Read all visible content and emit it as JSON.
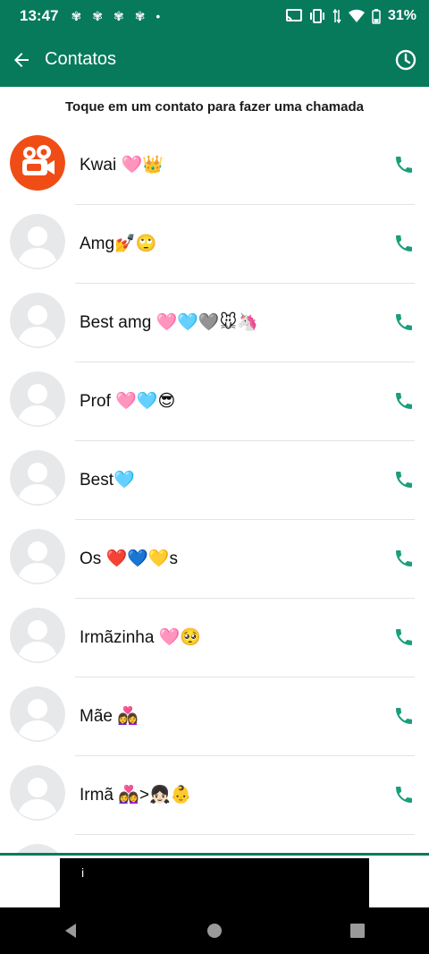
{
  "status_bar": {
    "time": "13:47",
    "notification_icons": [
      "status-icon-1",
      "status-icon-2",
      "status-icon-3",
      "status-icon-4",
      "dot"
    ],
    "battery": "31%"
  },
  "app_bar": {
    "title": "Contatos"
  },
  "hint": "Toque em um contato para fazer uma chamada",
  "contacts": [
    {
      "name": "Kwai 🩷👑",
      "avatar": "kwai"
    },
    {
      "name": "Amg💅🙄",
      "avatar": "default"
    },
    {
      "name": "Best amg 🩷🩵🩶🐭🦄",
      "avatar": "default"
    },
    {
      "name": "Prof 🩷🩵😎",
      "avatar": "default"
    },
    {
      "name": "Best🩵",
      "avatar": "default"
    },
    {
      "name": "Os ❤️💙💛s",
      "avatar": "default"
    },
    {
      "name": "Irmãzinha 🩷🥺",
      "avatar": "default"
    },
    {
      "name": "Mãe 👩‍❤️‍👩",
      "avatar": "default"
    },
    {
      "name": "Irmã 👩‍❤️‍👩>👧🏻👶",
      "avatar": "default"
    }
  ],
  "ad_banner": {
    "label": "i"
  },
  "colors": {
    "primary": "#077a5c",
    "call_icon": "#1a9e7c",
    "kwai": "#f04d16",
    "avatar_bg": "#e6e8ea",
    "avatar_fg": "#ffffff"
  }
}
